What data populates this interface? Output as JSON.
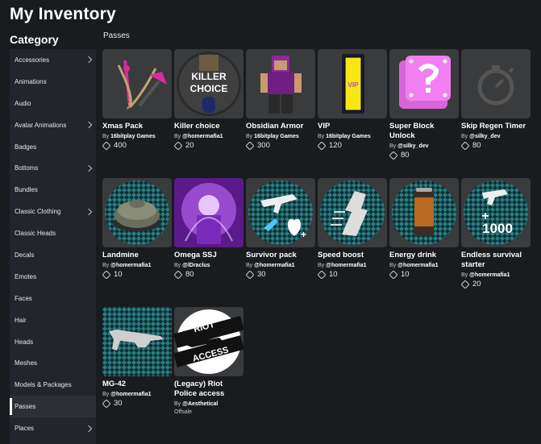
{
  "page": {
    "title": "My Inventory",
    "category_heading": "Category",
    "section": "Passes"
  },
  "sidebar": {
    "items": [
      {
        "label": "Accessories",
        "chevron": true
      },
      {
        "label": "Animations",
        "chevron": false
      },
      {
        "label": "Audio",
        "chevron": false
      },
      {
        "label": "Avatar Animations",
        "chevron": true
      },
      {
        "label": "Badges",
        "chevron": false
      },
      {
        "label": "Bottoms",
        "chevron": true
      },
      {
        "label": "Bundles",
        "chevron": false
      },
      {
        "label": "Classic Clothing",
        "chevron": true
      },
      {
        "label": "Classic Heads",
        "chevron": false
      },
      {
        "label": "Decals",
        "chevron": false
      },
      {
        "label": "Emotes",
        "chevron": false
      },
      {
        "label": "Faces",
        "chevron": false
      },
      {
        "label": "Hair",
        "chevron": false
      },
      {
        "label": "Heads",
        "chevron": false
      },
      {
        "label": "Meshes",
        "chevron": false
      },
      {
        "label": "Models & Packages",
        "chevron": false
      },
      {
        "label": "Passes",
        "chevron": false,
        "active": true
      },
      {
        "label": "Places",
        "chevron": true
      }
    ]
  },
  "items": [
    {
      "name": "Xmas Pack",
      "by": "By",
      "creator": "16bitplay Games",
      "price": "400",
      "icon": "xmas-pack-icon"
    },
    {
      "name": "Killer choice",
      "by": "By",
      "creator": "@homermafia1",
      "price": "20",
      "icon": "killer-choice-icon",
      "thumb_text": [
        "KILLER",
        "CHOICE"
      ]
    },
    {
      "name": "Obsidian Armor",
      "by": "By",
      "creator": "16bitplay Games",
      "price": "300",
      "icon": "obsidian-armor-icon"
    },
    {
      "name": "VIP",
      "by": "By",
      "creator": "16bitplay Games",
      "price": "120",
      "icon": "vip-icon",
      "thumb_text": [
        "VIP"
      ]
    },
    {
      "name": "Super Block Unlock",
      "by": "By",
      "creator": "@silky_dev",
      "price": "80",
      "icon": "super-block-icon"
    },
    {
      "name": "Skip Regen Timer",
      "by": "By",
      "creator": "@silky_dev",
      "price": "80",
      "icon": "stopwatch-icon"
    },
    {
      "name": "Landmine",
      "by": "By",
      "creator": "@homermafia1",
      "price": "10",
      "icon": "landmine-icon"
    },
    {
      "name": "Omega SSJ",
      "by": "By",
      "creator": "@lDraclus",
      "price": "80",
      "icon": "omega-ssj-icon"
    },
    {
      "name": "Survivor pack",
      "by": "By",
      "creator": "@homermafia1",
      "price": "30",
      "icon": "survivor-pack-icon"
    },
    {
      "name": "Speed boost",
      "by": "By",
      "creator": "@homermafia1",
      "price": "10",
      "icon": "speed-boost-icon"
    },
    {
      "name": "Energy drink",
      "by": "By",
      "creator": "@homermafia1",
      "price": "10",
      "icon": "energy-drink-icon"
    },
    {
      "name": "Endless survival starter",
      "by": "By",
      "creator": "@homermafia1",
      "price": "20",
      "icon": "endless-survival-icon",
      "thumb_text": [
        "+",
        "1000"
      ]
    },
    {
      "name": "MG-42",
      "by": "By",
      "creator": "@homermafia1",
      "price": "30",
      "icon": "mg42-icon"
    },
    {
      "name": "(Legacy) Riot Police access",
      "by": "By",
      "creator": "@Aesthetical",
      "price": null,
      "status": "Offsale",
      "icon": "riot-police-icon",
      "thumb_text": [
        "RIOT",
        "ACCESS"
      ]
    }
  ],
  "colors": {
    "background": "#191b1f",
    "sidebar": "#22252b",
    "thumb": "#393b3d",
    "accent_pink": "#d72e9b",
    "teal": "#1f6b6e"
  }
}
